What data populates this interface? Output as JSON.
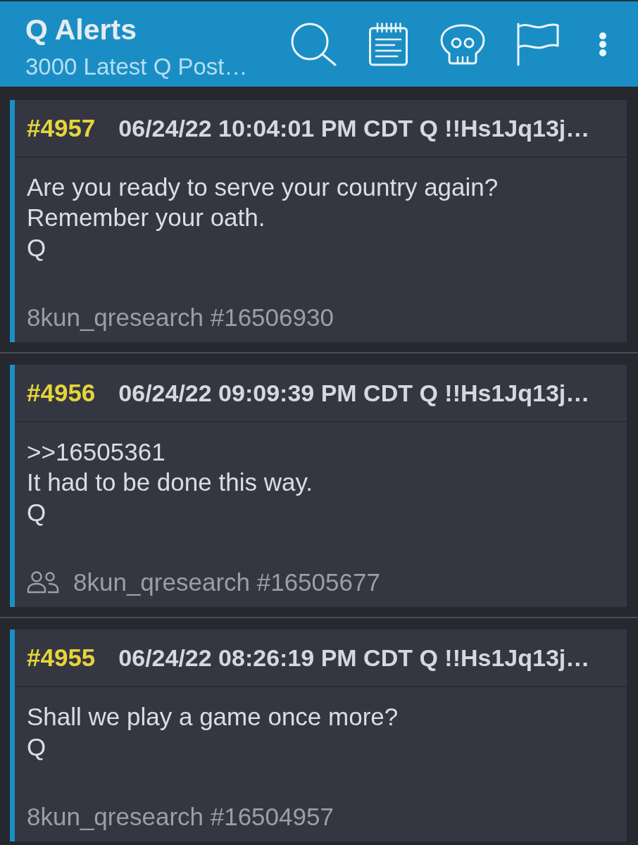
{
  "app_bar": {
    "title": "Q Alerts",
    "subtitle": "3000 Latest Q Post…"
  },
  "posts": [
    {
      "number": "#4957",
      "meta": "06/24/22 10:04:01 PM CDT Q !!Hs1Jq13j…",
      "body": [
        "Are you ready to serve your country again?",
        "Remember your oath.",
        "Q"
      ],
      "group_icon": false,
      "source": "8kun_qresearch #16506930"
    },
    {
      "number": "#4956",
      "meta": "06/24/22 09:09:39 PM CDT Q !!Hs1Jq13j…",
      "body": [
        ">>16505361",
        "It had to be done this way.",
        "Q"
      ],
      "group_icon": true,
      "source": "8kun_qresearch #16505677"
    },
    {
      "number": "#4955",
      "meta": "06/24/22 08:26:19 PM CDT Q !!Hs1Jq13j…",
      "body": [
        "Shall we play a game once more?",
        "Q"
      ],
      "group_icon": false,
      "source": "8kun_qresearch #16504957"
    }
  ]
}
